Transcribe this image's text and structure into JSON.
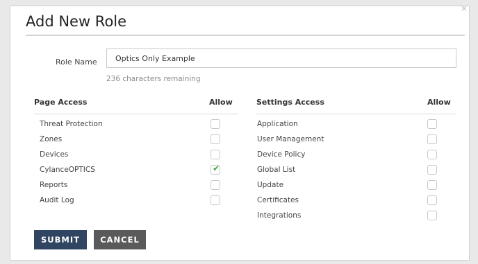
{
  "dialog": {
    "title": "Add New Role",
    "close_glyph": "×"
  },
  "role": {
    "label": "Role Name",
    "value": "Optics Only Example",
    "remaining": "236 characters remaining"
  },
  "page_access": {
    "header": "Page Access",
    "allow_header": "Allow",
    "items": [
      {
        "label": "Threat Protection",
        "checked": false
      },
      {
        "label": "Zones",
        "checked": false
      },
      {
        "label": "Devices",
        "checked": false
      },
      {
        "label": "CylanceOPTICS",
        "checked": true
      },
      {
        "label": "Reports",
        "checked": false
      },
      {
        "label": "Audit Log",
        "checked": false
      }
    ]
  },
  "settings_access": {
    "header": "Settings Access",
    "allow_header": "Allow",
    "items": [
      {
        "label": "Application",
        "checked": false
      },
      {
        "label": "User Management",
        "checked": false
      },
      {
        "label": "Device Policy",
        "checked": false
      },
      {
        "label": "Global List",
        "checked": false
      },
      {
        "label": "Update",
        "checked": false
      },
      {
        "label": "Certificates",
        "checked": false
      },
      {
        "label": "Integrations",
        "checked": false
      }
    ]
  },
  "buttons": {
    "submit": "SUBMIT",
    "cancel": "CANCEL"
  },
  "colors": {
    "submit_bg": "#2f4562",
    "cancel_bg": "#5a5a5a",
    "check": "#3aa83a"
  }
}
